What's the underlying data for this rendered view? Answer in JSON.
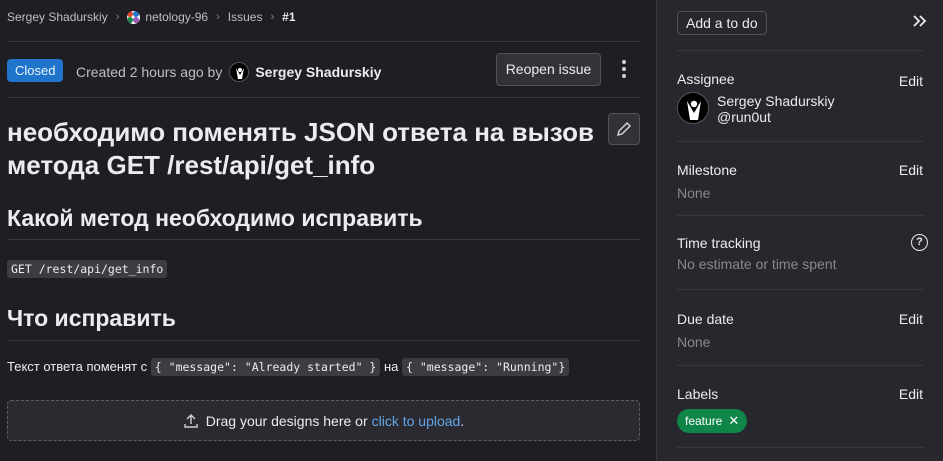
{
  "breadcrumb": {
    "user": "Sergey Shadurskiy",
    "project": "netology-96",
    "section": "Issues",
    "current": "#1"
  },
  "issue": {
    "status": "Closed",
    "created_prefix": "Created 2 hours ago by",
    "author": "Sergey Shadurskiy",
    "reopen_label": "Reopen issue",
    "title": "необходимо поменять JSON ответа на вызов метода GET /rest/api/get_info",
    "body": {
      "heading1": "Какой метод необходимо исправить",
      "code1": "GET /rest/api/get_info",
      "heading2": "Что исправить",
      "text_prefix": "Текст ответа поменят с",
      "code2": "{ \"message\": \"Already started\" }",
      "text_middle": "на",
      "code3": "{ \"message\": \"Running\"}"
    },
    "dropzone": {
      "text": "Drag your designs here or",
      "link": "click to upload",
      "suffix": "."
    }
  },
  "sidebar": {
    "todo_label": "Add a to do",
    "edit_label": "Edit",
    "assignee": {
      "label": "Assignee",
      "name": "Sergey Shadurskiy",
      "handle": "@run0ut"
    },
    "milestone": {
      "label": "Milestone",
      "value": "None"
    },
    "time_tracking": {
      "label": "Time tracking",
      "value": "No estimate or time spent",
      "help": "?"
    },
    "due_date": {
      "label": "Due date",
      "value": "None"
    },
    "labels": {
      "label": "Labels",
      "items": [
        "feature"
      ],
      "remove": "✕"
    }
  },
  "colors": {
    "status_closed": "#1f75cb",
    "label_feature": "#108548",
    "link": "#63a6e9"
  }
}
